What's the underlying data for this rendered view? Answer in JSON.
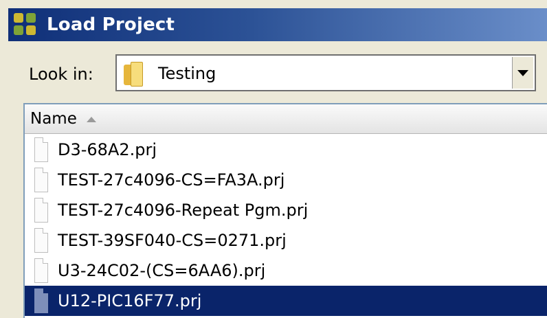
{
  "window": {
    "title": "Load Project",
    "app_icon": "green-yellow-squares-icon"
  },
  "look_in": {
    "label": "Look in:",
    "value": "Testing",
    "folder_icon": "folder-icon"
  },
  "file_list": {
    "columns": [
      {
        "label": "Name",
        "sort": "ascending"
      }
    ],
    "files": [
      {
        "name": "D3-68A2.prj",
        "selected": false
      },
      {
        "name": "TEST-27c4096-CS=FA3A.prj",
        "selected": false
      },
      {
        "name": "TEST-27c4096-Repeat Pgm.prj",
        "selected": false
      },
      {
        "name": "TEST-39SF040-CS=0271.prj",
        "selected": false
      },
      {
        "name": "U3-24C02-(CS=6AA6).prj",
        "selected": false
      },
      {
        "name": "U12-PIC16F77.prj",
        "selected": true
      }
    ]
  },
  "colors": {
    "titlebar_start": "#0f2f78",
    "titlebar_end": "#6a8ec9",
    "selection": "#0a246a"
  }
}
